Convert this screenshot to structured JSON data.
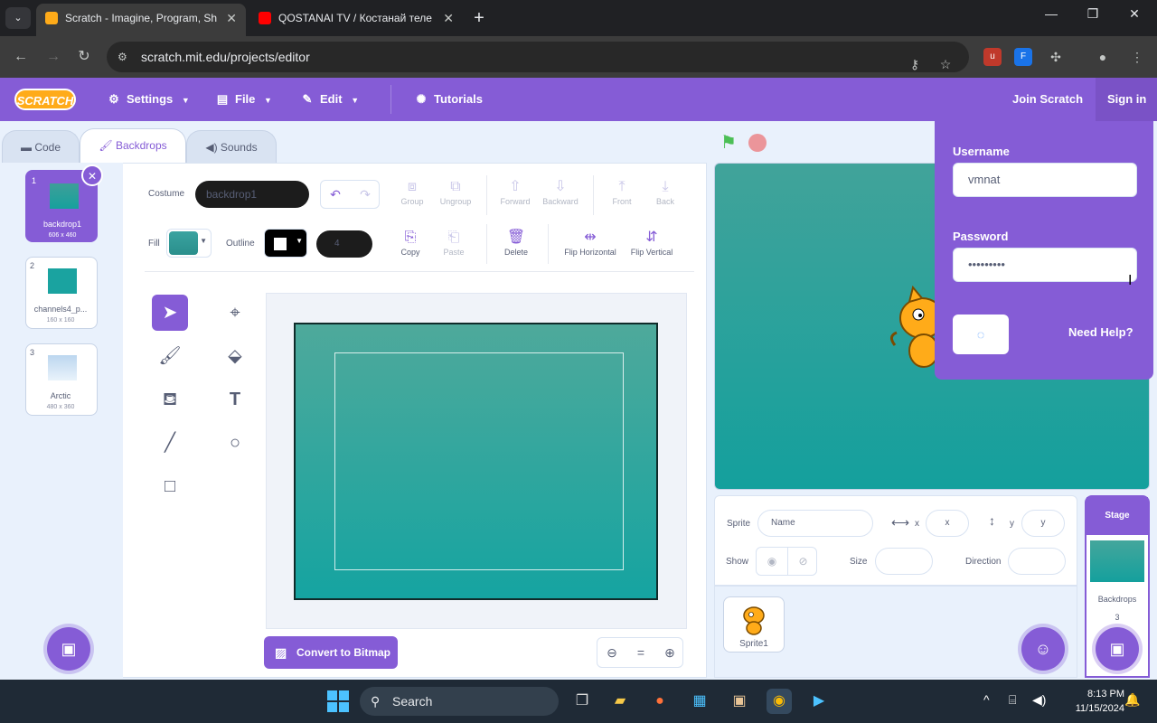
{
  "browser": {
    "tabs": [
      {
        "title": "Scratch - Imagine, Program, Sh",
        "active": true
      },
      {
        "title": "QOSTANAI TV / Костанай теле",
        "active": false
      }
    ],
    "url": "scratch.mit.edu/projects/editor",
    "new_tab": "+",
    "tab_close": "✕"
  },
  "menu": {
    "logo": "SCRATCH",
    "settings": "Settings",
    "file": "File",
    "edit": "Edit",
    "tutorials": "Tutorials",
    "join": "Join Scratch",
    "signin": "Sign in"
  },
  "editor_tabs": {
    "code": "Code",
    "backdrops": "Backdrops",
    "sounds": "Sounds"
  },
  "backdrops": [
    {
      "num": "1",
      "name": "backdrop1",
      "size": "606 x 460"
    },
    {
      "num": "2",
      "name": "channels4_p...",
      "size": "160 x 160"
    },
    {
      "num": "3",
      "name": "Arctic",
      "size": "480 x 360"
    }
  ],
  "paint": {
    "costume_label": "Costume",
    "costume_name": "backdrop1",
    "fill_label": "Fill",
    "outline_label": "Outline",
    "stroke_width": "4",
    "tools_row1": [
      "Group",
      "Ungroup",
      "Forward",
      "Backward",
      "Front",
      "Back"
    ],
    "tools_row2": [
      "Copy",
      "Paste",
      "Delete",
      "Flip Horizontal",
      "Flip Vertical"
    ],
    "convert": "Convert to Bitmap",
    "zoom_equal": "="
  },
  "sprite_info": {
    "sprite_label": "Sprite",
    "name_placeholder": "Name",
    "x_label": "x",
    "x_placeholder": "x",
    "y_label": "y",
    "y_placeholder": "y",
    "show_label": "Show",
    "size_label": "Size",
    "direction_label": "Direction"
  },
  "sprites": [
    {
      "name": "Sprite1"
    }
  ],
  "stage_panel": {
    "header": "Stage",
    "backdrops_label": "Backdrops",
    "backdrops_count": "3"
  },
  "login": {
    "username_label": "Username",
    "username_value": "vmnat",
    "password_label": "Password",
    "password_value": "•••••••••",
    "need_help": "Need Help?"
  },
  "taskbar": {
    "search": "Search",
    "time": "8:13 PM",
    "date": "11/15/2024"
  },
  "colors": {
    "scratch_purple": "#855cd6",
    "backdrop_teal": "#15a4a1",
    "chrome_dark": "#202124"
  }
}
